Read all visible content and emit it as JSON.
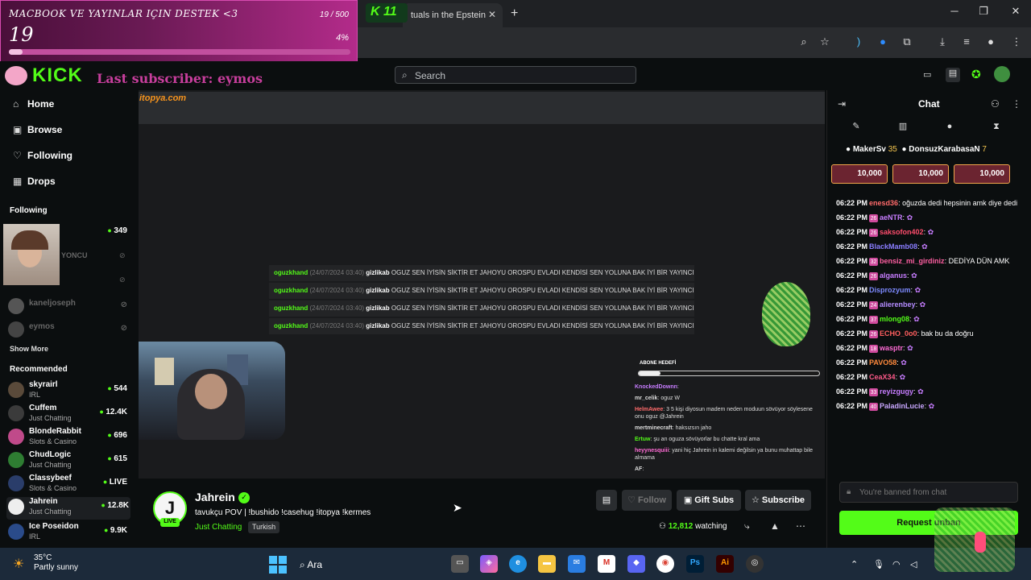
{
  "browser": {
    "tab_title": "tuals in the Epstein",
    "new_tab": "+",
    "kick_badge": "11"
  },
  "donation_widget": {
    "title": "MACBOOK VE YAYINLAR IÇIN DESTEK <3",
    "count": "19",
    "goal": "19 / 500",
    "percent": "4%",
    "progress": 0.04
  },
  "header": {
    "logo": "KICK",
    "last_subscriber": "Last subscriber: eymos",
    "search_placeholder": "Search"
  },
  "sidebar": {
    "nav": [
      {
        "label": "Home",
        "icon": "home-icon"
      },
      {
        "label": "Browse",
        "icon": "browse-icon"
      },
      {
        "label": "Following",
        "icon": "heart-icon"
      },
      {
        "label": "Drops",
        "icon": "drops-icon"
      }
    ],
    "following_heading": "Following",
    "following": [
      {
        "name": "",
        "category": "",
        "viewers": "349"
      },
      {
        "name": "YONCU",
        "category": "",
        "viewers": ""
      },
      {
        "name": "",
        "category": "",
        "viewers": ""
      },
      {
        "name": "kaneljoseph",
        "category": "",
        "viewers": ""
      },
      {
        "name": "eymos",
        "category": "",
        "viewers": ""
      }
    ],
    "show_more": "Show More",
    "recommended_heading": "Recommended",
    "recommended": [
      {
        "name": "skyrairl",
        "category": "IRL",
        "viewers": "544"
      },
      {
        "name": "Cuffem",
        "category": "Just Chatting",
        "viewers": "12.4K"
      },
      {
        "name": "BlondeRabbit",
        "category": "Slots & Casino",
        "viewers": "696"
      },
      {
        "name": "ChudLogic",
        "category": "Just Chatting",
        "viewers": "615"
      },
      {
        "name": "Classybeef",
        "category": "Slots & Casino",
        "viewers": "LIVE"
      },
      {
        "name": "Jahrein",
        "category": "Just Chatting",
        "viewers": "12.8K"
      },
      {
        "name": "Ice Poseidon",
        "category": "IRL",
        "viewers": "9.9K"
      }
    ]
  },
  "video": {
    "inner_logo": "itopya.com",
    "messages": [
      {
        "user": "oguzkhand",
        "date": "(24/07/2024 03:40)",
        "target": "gizlikab",
        "text": "OGUZ SEN İYİSİN SİKTİR ET JAHOYU OROSPU EVLADI KENDİSİ SEN YOLUNA BAK İYİ BİR YAYINCISIN"
      },
      {
        "user": "oguzkhand",
        "date": "(24/07/2024 03:40)",
        "target": "gizlikab",
        "text": "OGUZ SEN İYİSİN SİKTİR ET JAHOYU OROSPU EVLADI KENDİSİ SEN YOLUNA BAK İYİ BİR YAYINCISIN"
      },
      {
        "user": "oguzkhand",
        "date": "(24/07/2024 03:40)",
        "target": "gizlikab",
        "text": "OGUZ SEN İYİSİN SİKTİR ET JAHOYU OROSPU EVLADI KENDİSİ SEN YOLUNA BAK İYİ BİR YAYINCISIN"
      },
      {
        "user": "oguzkhand",
        "date": "(24/07/2024 03:40)",
        "target": "gizlikab",
        "text": "OGUZ SEN İYİSİN SİKTİR ET JAHOYU OROSPU EVLADI KENDİSİ SEN YOLUNA BAK İYİ BİR YAYINCISIN"
      }
    ],
    "abone_hedefi": "ABONE HEDEFİ",
    "abone_progress": 0.12,
    "overlay_chat": [
      {
        "user": "KnockedDownn",
        "text": ""
      },
      {
        "user": "mr_celik",
        "text": "oguz W"
      },
      {
        "user": "HelmAwee",
        "text": "3 5 kişi diyosun madem neden moduun sövüyor söylesene onu oguz @Jahrein"
      },
      {
        "user": "mertminecraft",
        "text": "haksızsın jaho"
      },
      {
        "user": "Ertuw",
        "text": "şu an oguza sövüyorlar bu chatte kral ama"
      },
      {
        "user": "heyynesquiii",
        "text": "yani hiç Jahrein in kalemi değilsin ya bunu muhattap bile almama"
      },
      {
        "user": "AF",
        "text": ""
      }
    ]
  },
  "stream": {
    "streamer": "Jahrein",
    "live": "LIVE",
    "title": "tavukçu POV | !bushido !casehug !itopya !kermes",
    "category": "Just Chatting",
    "tag": "Turkish",
    "follow": "Follow",
    "gift_subs": "Gift Subs",
    "subscribe": "Subscribe",
    "watching_count": "12,812",
    "watching_label": "watching"
  },
  "chat": {
    "title": "Chat",
    "gifters": [
      {
        "name": "MakerSv",
        "count": "35"
      },
      {
        "name": "DonsuzKarabasaN",
        "count": "7"
      }
    ],
    "gift_amounts": [
      "10,000",
      "10,000",
      "10,000"
    ],
    "messages": [
      {
        "time": "06:22 PM",
        "badge": "",
        "user": "enesd36",
        "color": "#ff6b6b",
        "text": "oğuzda dedi hepsinin amk diye dedi"
      },
      {
        "time": "06:22 PM",
        "badge": "26",
        "user": "aeNTR",
        "color": "#c77dff",
        "text": ""
      },
      {
        "time": "06:22 PM",
        "badge": "26",
        "user": "saksofon402",
        "color": "#ff4d6d",
        "text": ""
      },
      {
        "time": "06:22 PM",
        "badge": "",
        "user": "BlackMamb08",
        "color": "#8a7dff",
        "text": ""
      },
      {
        "time": "06:22 PM",
        "badge": "32",
        "user": "bensiz_mi_girdiniz",
        "color": "#ff5fa2",
        "text": "DEDİYA DÜN AMK"
      },
      {
        "time": "06:22 PM",
        "badge": "26",
        "user": "alganus",
        "color": "#c77dff",
        "text": ""
      },
      {
        "time": "06:22 PM",
        "badge": "",
        "user": "Disprozyum",
        "color": "#7d8aff",
        "text": ""
      },
      {
        "time": "06:22 PM",
        "badge": "24",
        "user": "alierenbey",
        "color": "#b48bff",
        "text": ""
      },
      {
        "time": "06:22 PM",
        "badge": "37",
        "user": "mlong08",
        "color": "#53fc18",
        "text": ""
      },
      {
        "time": "06:22 PM",
        "badge": "26",
        "user": "ECHO_0o0",
        "color": "#ff5f5f",
        "text": "bak bu da doğru"
      },
      {
        "time": "06:22 PM",
        "badge": "18",
        "user": "wasptr",
        "color": "#ff6bd5",
        "text": ""
      },
      {
        "time": "06:22 PM",
        "badge": "",
        "user": "PAVO58",
        "color": "#ff8a3d",
        "text": ""
      },
      {
        "time": "06:22 PM",
        "badge": "",
        "user": "CeaX34",
        "color": "#ff5a8a",
        "text": ""
      },
      {
        "time": "06:22 PM",
        "badge": "33",
        "user": "reyizgugy",
        "color": "#c77dff",
        "text": ""
      },
      {
        "time": "06:22 PM",
        "badge": "40",
        "user": "PaladinLucie",
        "color": "#c9a8ff",
        "text": ""
      }
    ],
    "banned_placeholder": "You're banned from chat",
    "request_unban": "Request unban"
  },
  "taskbar": {
    "temperature": "35°C",
    "weather": "Partly sunny",
    "search_label": "Ara"
  }
}
